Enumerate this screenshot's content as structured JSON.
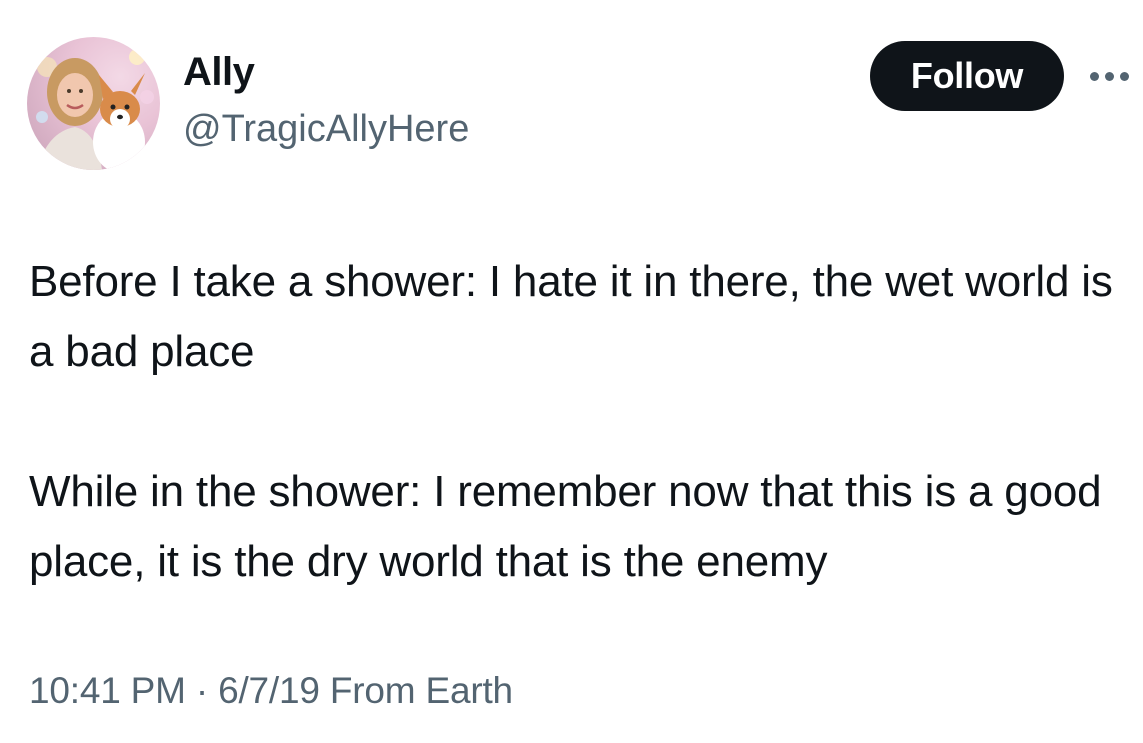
{
  "author": {
    "display_name": "Ally",
    "handle": "@TragicAllyHere"
  },
  "actions": {
    "follow_label": "Follow",
    "more_icon": "more-horizontal-icon"
  },
  "tweet": {
    "paragraphs": [
      "Before I take a shower: I hate it in there, the wet world is a bad place",
      "While in the shower: I remember now that this is a good place, it is the dry world that is the enemy"
    ],
    "time": "10:41 PM",
    "separator": "·",
    "date": "6/7/19",
    "source": "From Earth"
  },
  "colors": {
    "text_primary": "#0f1419",
    "text_secondary": "#536471",
    "follow_bg": "#0f1419",
    "follow_text": "#ffffff"
  }
}
